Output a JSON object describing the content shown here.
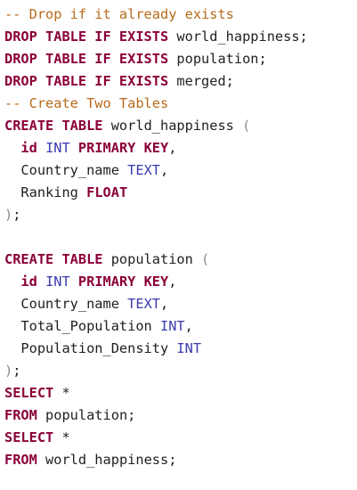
{
  "editor": {
    "lines": [
      [
        {
          "t": "-- Drop if it already exists",
          "c": "comment"
        }
      ],
      [
        {
          "t": "DROP TABLE IF EXISTS",
          "c": "kw"
        },
        {
          "t": " world_happiness;",
          "c": "ident"
        }
      ],
      [
        {
          "t": "DROP TABLE IF EXISTS",
          "c": "kw"
        },
        {
          "t": " population;",
          "c": "ident"
        }
      ],
      [
        {
          "t": "DROP TABLE IF EXISTS",
          "c": "kw"
        },
        {
          "t": " merged;",
          "c": "ident"
        }
      ],
      [
        {
          "t": "-- Create Two Tables",
          "c": "comment"
        }
      ],
      [
        {
          "t": "CREATE TABLE",
          "c": "kw"
        },
        {
          "t": " world_happiness ",
          "c": "ident"
        },
        {
          "t": "(",
          "c": "punc"
        }
      ],
      [
        {
          "t": "  ",
          "c": "ident"
        },
        {
          "t": "id",
          "c": "kw"
        },
        {
          "t": " ",
          "c": "ident"
        },
        {
          "t": "INT",
          "c": "kw-blue"
        },
        {
          "t": " ",
          "c": "ident"
        },
        {
          "t": "PRIMARY KEY",
          "c": "kw"
        },
        {
          "t": ",",
          "c": "ident"
        }
      ],
      [
        {
          "t": "  Country_name ",
          "c": "ident"
        },
        {
          "t": "TEXT",
          "c": "kw-blue"
        },
        {
          "t": ",",
          "c": "ident"
        }
      ],
      [
        {
          "t": "  Ranking ",
          "c": "ident"
        },
        {
          "t": "FLOAT",
          "c": "kw"
        }
      ],
      [
        {
          "t": ")",
          "c": "punc"
        },
        {
          "t": ";",
          "c": "ident"
        }
      ],
      [],
      [
        {
          "t": "CREATE TABLE",
          "c": "kw"
        },
        {
          "t": " population ",
          "c": "ident"
        },
        {
          "t": "(",
          "c": "punc"
        }
      ],
      [
        {
          "t": "  ",
          "c": "ident"
        },
        {
          "t": "id",
          "c": "kw"
        },
        {
          "t": " ",
          "c": "ident"
        },
        {
          "t": "INT",
          "c": "kw-blue"
        },
        {
          "t": " ",
          "c": "ident"
        },
        {
          "t": "PRIMARY KEY",
          "c": "kw"
        },
        {
          "t": ",",
          "c": "ident"
        }
      ],
      [
        {
          "t": "  Country_name ",
          "c": "ident"
        },
        {
          "t": "TEXT",
          "c": "kw-blue"
        },
        {
          "t": ",",
          "c": "ident"
        }
      ],
      [
        {
          "t": "  Total_Population ",
          "c": "ident"
        },
        {
          "t": "INT",
          "c": "kw-blue"
        },
        {
          "t": ",",
          "c": "ident"
        }
      ],
      [
        {
          "t": "  Population_Density ",
          "c": "ident"
        },
        {
          "t": "INT",
          "c": "kw-blue"
        }
      ],
      [
        {
          "t": ")",
          "c": "punc"
        },
        {
          "t": ";",
          "c": "ident"
        }
      ],
      [
        {
          "t": "SELECT",
          "c": "kw"
        },
        {
          "t": " *",
          "c": "ident"
        }
      ],
      [
        {
          "t": "FROM",
          "c": "kw"
        },
        {
          "t": " population;",
          "c": "ident"
        }
      ],
      [
        {
          "t": "SELECT",
          "c": "kw"
        },
        {
          "t": " *",
          "c": "ident"
        }
      ],
      [
        {
          "t": "FROM",
          "c": "kw"
        },
        {
          "t": " world_happiness;",
          "c": "ident"
        }
      ]
    ]
  },
  "colors": {
    "keyword": "#8b0039",
    "type_keyword": "#3a3ab0",
    "comment": "#b96a1c",
    "punctuation": "#8b8b8b",
    "text": "#1f1f1f",
    "background": "#ffffff"
  }
}
